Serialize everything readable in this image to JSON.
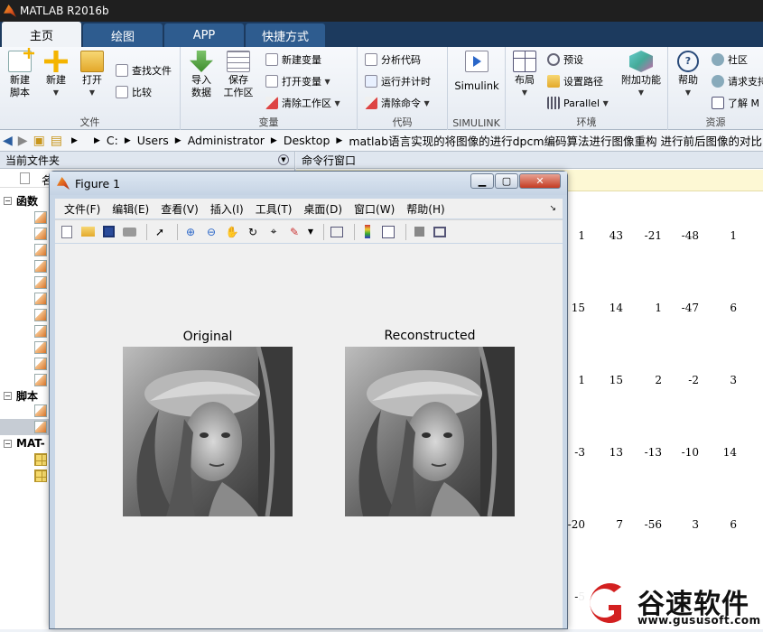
{
  "window_title": "MATLAB R2016b",
  "tabs": [
    {
      "label": "主页"
    },
    {
      "label": "绘图"
    },
    {
      "label": "APP"
    },
    {
      "label": "快捷方式"
    }
  ],
  "ribbon": {
    "file": {
      "label": "文件",
      "new_script": "新建\n脚本",
      "new": "新建",
      "open": "打开",
      "find_files": "查找文件",
      "compare": "比较"
    },
    "variable": {
      "label": "变量",
      "import": "导入\n数据",
      "save_ws": "保存\n工作区",
      "new_var": "新建变量",
      "open_var": "打开变量",
      "clear_ws": "清除工作区"
    },
    "code": {
      "label": "代码",
      "analyze": "分析代码",
      "run_time": "运行并计时",
      "clear_cmd": "清除命令"
    },
    "simulink": {
      "label": "SIMULINK",
      "simulink": "Simulink"
    },
    "env": {
      "label": "环境",
      "layout": "布局",
      "prefs": "预设",
      "set_path": "设置路径",
      "parallel": "Parallel",
      "addons": "附加功能"
    },
    "res": {
      "label": "资源",
      "help": "帮助",
      "community": "社区",
      "request": "请求支持",
      "learn": "了解 M"
    }
  },
  "address": [
    "C:",
    "Users",
    "Administrator",
    "Desktop",
    "matlab语言实现的将图像的进行dpcm编码算法进行图像重构 进行前后图像的对比"
  ],
  "left_panel": {
    "title": "当前文件夹",
    "col_name": "名",
    "sections": [
      {
        "label": "函数"
      },
      {
        "label": "脚本"
      },
      {
        "label": "MAT-"
      }
    ]
  },
  "right_panel": {
    "title": "命令行窗口"
  },
  "cmd_rows": [
    [
      "1",
      "43",
      "-21",
      "-48",
      "1"
    ],
    [
      "15",
      "14",
      "1",
      "-47",
      "6"
    ],
    [
      "1",
      "15",
      "2",
      "-2",
      "3"
    ],
    [
      "-3",
      "13",
      "-13",
      "-10",
      "14"
    ],
    [
      "-20",
      "7",
      "-56",
      "3",
      "6"
    ],
    [
      "-5",
      "",
      "",
      "",
      ""
    ]
  ],
  "figure": {
    "title": "Figure 1",
    "menu": [
      "文件(F)",
      "编辑(E)",
      "查看(V)",
      "插入(I)",
      "工具(T)",
      "桌面(D)",
      "窗口(W)",
      "帮助(H)"
    ],
    "axes": [
      {
        "title": "Original"
      },
      {
        "title": "Reconstructed"
      }
    ]
  },
  "watermark": {
    "brand": "谷速软件",
    "url": "www.gususoft.com",
    "color": "#d32020"
  }
}
